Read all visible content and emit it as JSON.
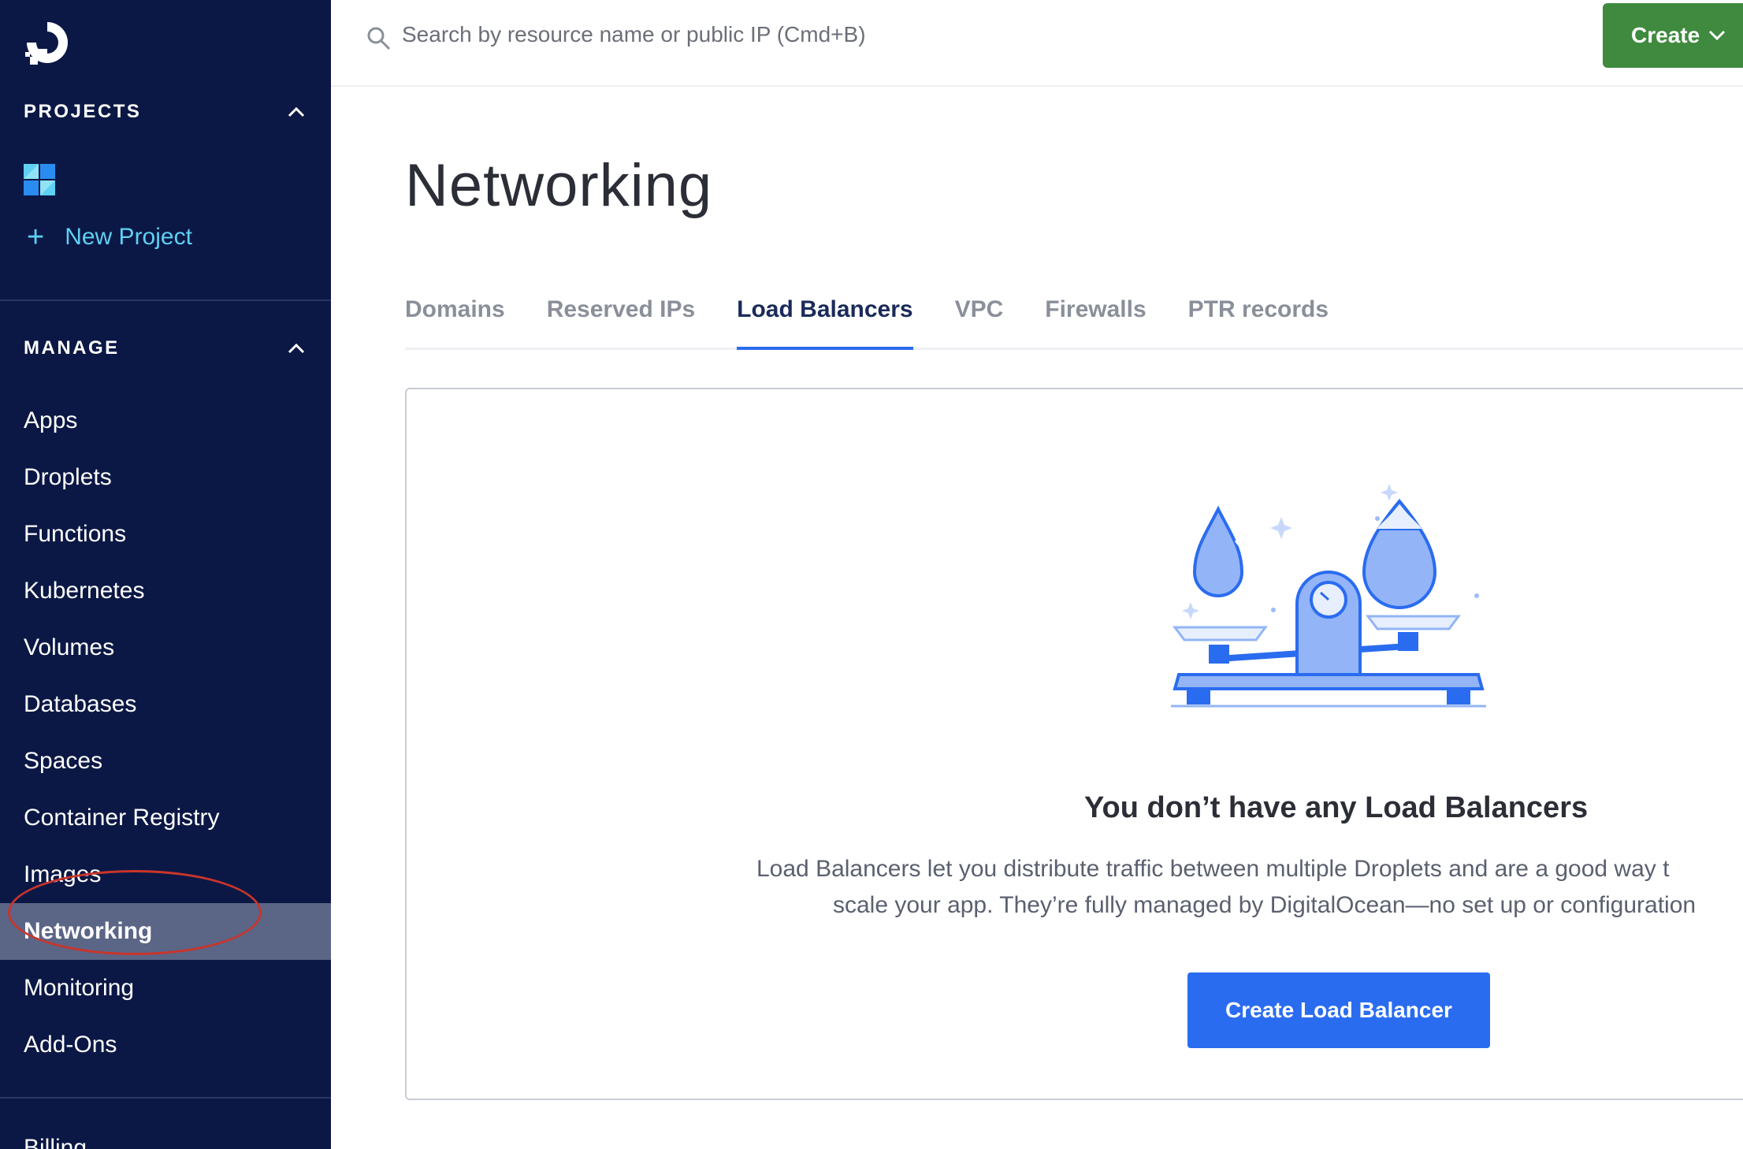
{
  "search": {
    "placeholder": "Search by resource name or public IP (Cmd+B)"
  },
  "header": {
    "create_label": "Create"
  },
  "sidebar": {
    "projects_heading": "PROJECTS",
    "new_project_label": "New Project",
    "manage_heading": "MANAGE",
    "items": [
      {
        "label": "Apps"
      },
      {
        "label": "Droplets"
      },
      {
        "label": "Functions"
      },
      {
        "label": "Kubernetes"
      },
      {
        "label": "Volumes"
      },
      {
        "label": "Databases"
      },
      {
        "label": "Spaces"
      },
      {
        "label": "Container Registry"
      },
      {
        "label": "Images"
      },
      {
        "label": "Networking",
        "active": true
      },
      {
        "label": "Monitoring"
      },
      {
        "label": "Add-Ons"
      }
    ],
    "billing_label": "Billing"
  },
  "page": {
    "title": "Networking",
    "tabs": [
      {
        "label": "Domains"
      },
      {
        "label": "Reserved IPs"
      },
      {
        "label": "Load Balancers",
        "active": true
      },
      {
        "label": "VPC"
      },
      {
        "label": "Firewalls"
      },
      {
        "label": "PTR records"
      }
    ]
  },
  "empty_state": {
    "title": "You don’t have any Load Balancers",
    "description_line1": "Load Balancers let you distribute traffic between multiple Droplets and are a good way t",
    "description_line2": "scale your app. They’re fully managed by DigitalOcean—no set up or configuration",
    "button_label": "Create Load Balancer"
  },
  "colors": {
    "sidebar_bg": "#0b1845",
    "accent": "#2a6cf0",
    "create_button": "#3f8a3e",
    "link": "#5fd0f3",
    "annotation": "#c9352b"
  }
}
